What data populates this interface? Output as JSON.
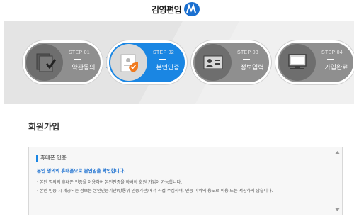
{
  "brand": {
    "name": "김영편입"
  },
  "steps": [
    {
      "num": "STEP 01",
      "label": "약관동의",
      "icon": "document-check-icon",
      "active": false
    },
    {
      "num": "STEP 02",
      "label": "본인인증",
      "icon": "id-shield-icon",
      "active": true
    },
    {
      "num": "STEP 03",
      "label": "정보입력",
      "icon": "id-card-icon",
      "active": false
    },
    {
      "num": "STEP 04",
      "label": "가입완료",
      "icon": "monitor-icon",
      "active": false
    }
  ],
  "page": {
    "title": "회원가입"
  },
  "panel": {
    "title": "휴대폰 인증",
    "lead": "본인 명의의 휴대폰으로 본인임을 확인합니다.",
    "lines": [
      "· 본인 명의의 휴대폰 인증을 이용하여 본인인증을 하셔야 회원 가입이 가능합니다.",
      "· 본인 인증 시 제공되는 정보는 본인인증기관(방통위 인증기관)에서 직접 수집하며, 인증 이외의 용도로 이용 또는 저장하지 않습니다."
    ]
  },
  "colors": {
    "accent": "#1a86e3",
    "inactive": "#8f8f8f",
    "band": "#ececec"
  }
}
